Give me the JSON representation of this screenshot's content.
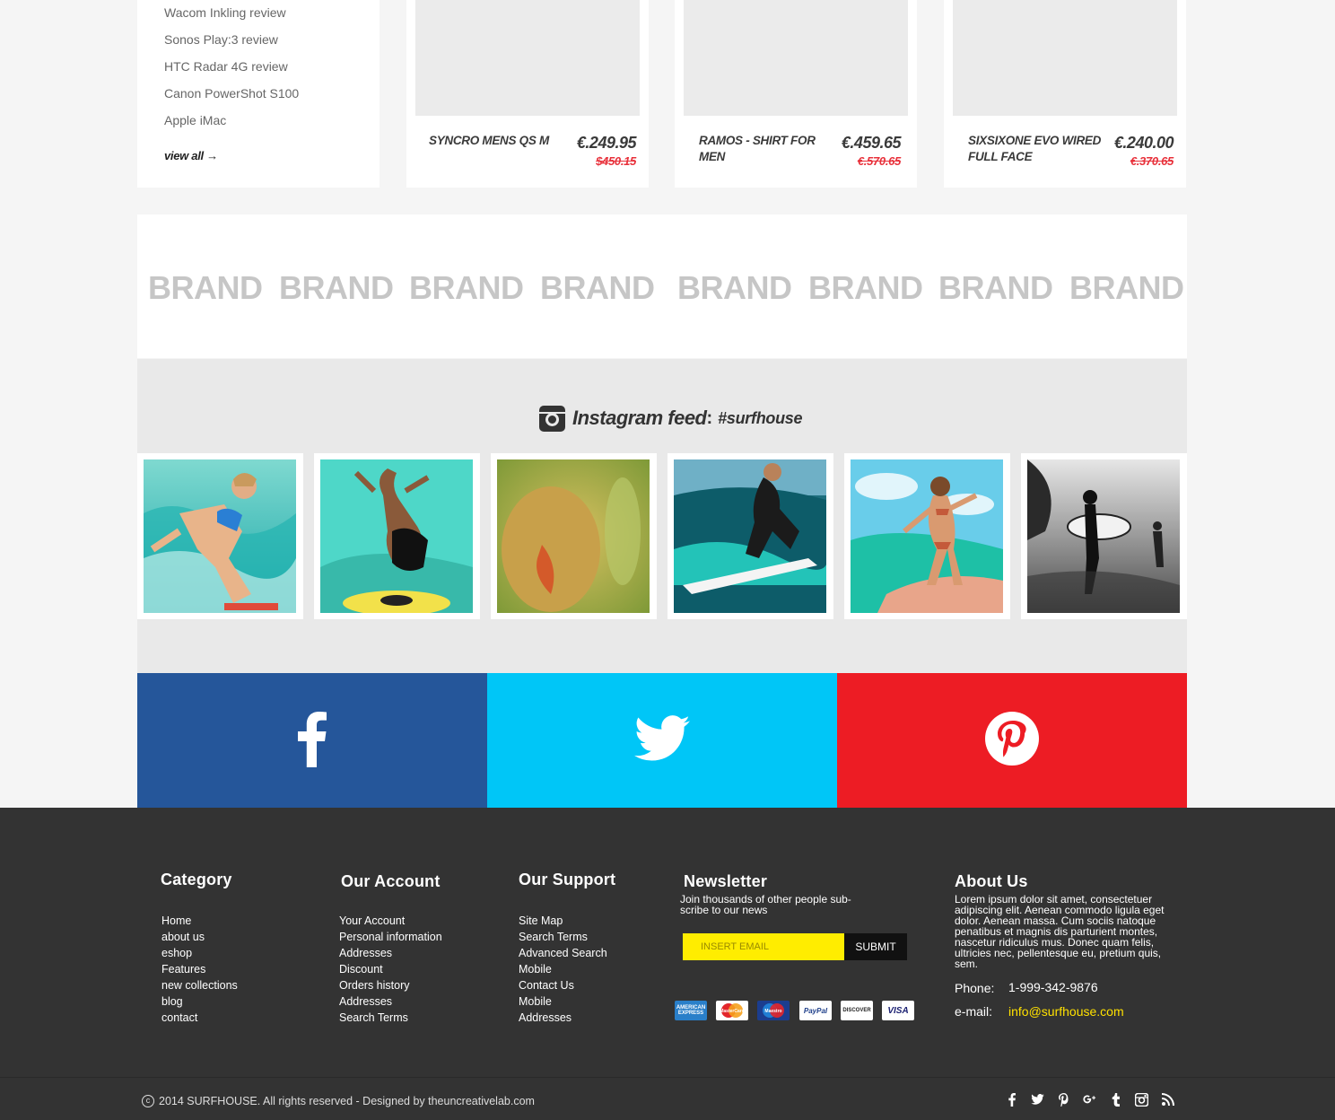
{
  "reviews": {
    "items": [
      "Wacom Inkling review",
      "Sonos Play:3 review",
      "HTC Radar 4G review",
      "Canon PowerShot S100",
      "Apple iMac"
    ],
    "view_all": "view all →"
  },
  "products": [
    {
      "name": "SYNCRO MENS QS M",
      "price": "€.249.95",
      "old_price": "$450.15"
    },
    {
      "name": "RAMOS - SHIRT FOR MEN",
      "price": "€.459.65",
      "old_price": "€.570.65"
    },
    {
      "name": "SIXSIXONE EVO WIRED FULL FACE",
      "price": "€.240.00",
      "old_price": "€.370.65"
    }
  ],
  "brands": [
    "BRAND",
    "BRAND",
    "BRAND",
    "BRAND",
    "BRAND",
    "BRAND",
    "BRAND",
    "BRAND"
  ],
  "instagram": {
    "label": "Instagram feed",
    "colon": ":",
    "tag": "#surfhouse",
    "icon": "instagram-icon"
  },
  "social": {
    "facebook_icon": "facebook-icon",
    "twitter_icon": "twitter-icon",
    "pinterest_icon": "pinterest-icon",
    "colors": {
      "facebook": "#25569a",
      "twitter": "#00c6f7",
      "pinterest": "#ed1c24"
    }
  },
  "footer": {
    "category": {
      "title": "Category",
      "items": [
        "Home",
        "about us",
        "eshop",
        "Features",
        "new collections",
        "blog",
        "contact"
      ]
    },
    "account": {
      "title": "Our Account",
      "items": [
        "Your Account",
        "Personal information",
        "Addresses",
        "Discount",
        "Orders history",
        "Addresses",
        "Search Terms"
      ]
    },
    "support": {
      "title": "Our Support",
      "items": [
        "Site Map",
        "Search Terms",
        "Advanced Search",
        "Mobile",
        "Contact Us",
        "Mobile",
        "Addresses"
      ]
    },
    "newsletter": {
      "title": "Newsletter",
      "text": "Join thousands of other people sub- scribe to our news",
      "placeholder": "INSERT EMAIL",
      "submit": "SUBMIT"
    },
    "payments": [
      "AMERICAN EXPRESS",
      "MasterCard",
      "Maestro",
      "PayPal",
      "DISCOVER",
      "VISA"
    ],
    "about": {
      "title": "About Us",
      "text": "Lorem ipsum dolor sit amet, consectetuer adipiscing elit. Aenean commodo ligula eget dolor. Aenean massa. Cum sociis natoque penatibus et magnis dis parturient montes, nascetur ridiculus mus. Donec quam felis, ultricies nec, pellentesque eu, pretium quis, sem.",
      "phone_label": "Phone:",
      "phone": "1-999-342-9876",
      "email_label": "e-mail:",
      "email": "info@surfhouse.com"
    },
    "accent": "#ffe100"
  },
  "bottom": {
    "copyright": "2014  SURFHOUSE. All rights reserved - Designed by theuncreativelab.com",
    "icons": [
      "facebook-icon",
      "twitter-icon",
      "pinterest-icon",
      "google-plus-icon",
      "tumblr-icon",
      "instagram-icon",
      "rss-icon"
    ]
  }
}
